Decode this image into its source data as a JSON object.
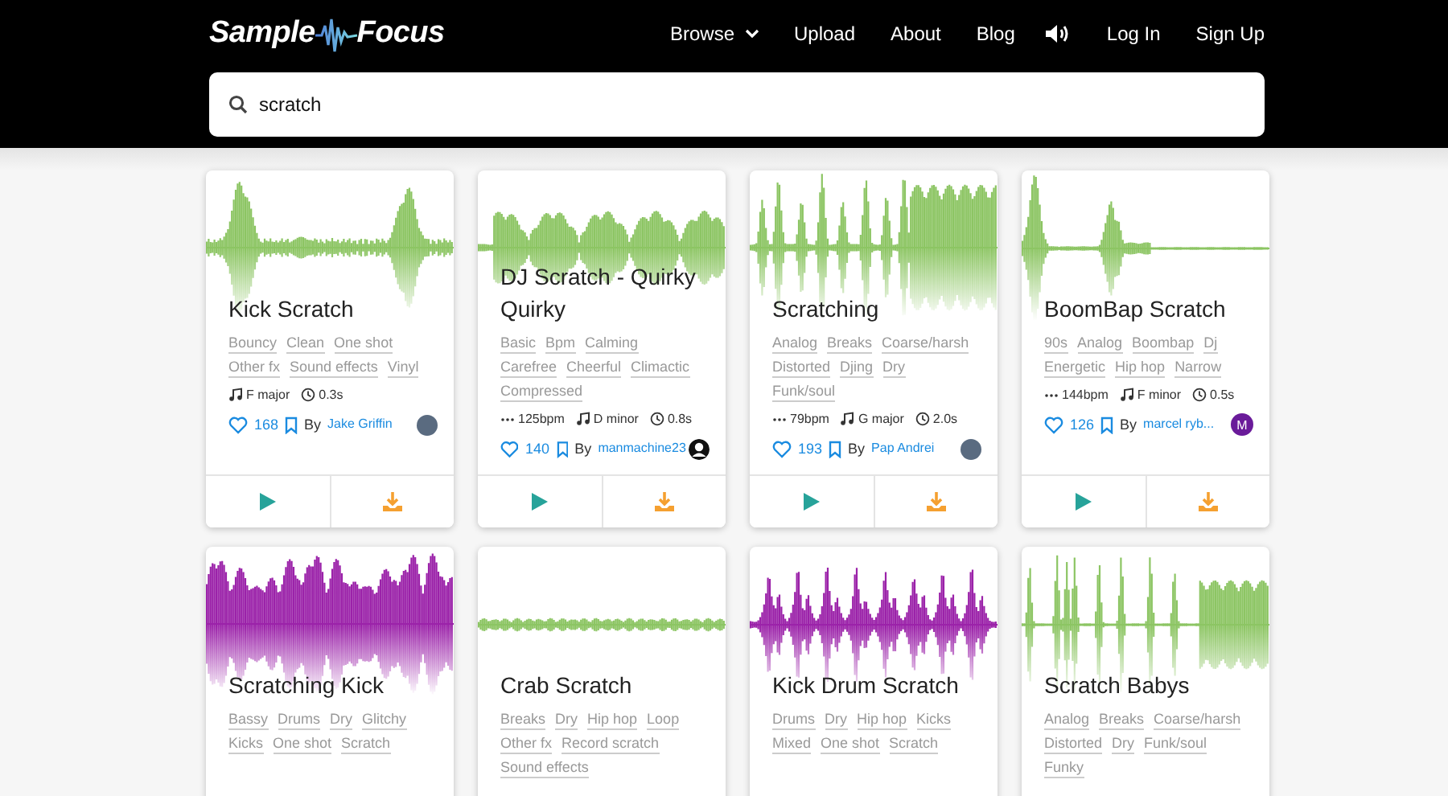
{
  "header": {
    "logo": {
      "left": "Sample",
      "right": "Focus"
    },
    "nav": [
      {
        "kind": "dropdown",
        "label": "Browse"
      },
      {
        "kind": "link",
        "label": "Upload"
      },
      {
        "kind": "link",
        "label": "About"
      },
      {
        "kind": "link",
        "label": "Blog"
      },
      {
        "kind": "sound"
      },
      {
        "kind": "link",
        "label": "Log In"
      },
      {
        "kind": "link",
        "label": "Sign Up"
      }
    ]
  },
  "search": {
    "value": "scratch"
  },
  "samples": [
    {
      "title": "Kick Scratch",
      "color": "#8cc563",
      "tags": [
        "Bouncy",
        "Clean",
        "One shot",
        "Other fx",
        "Sound effects",
        "Vinyl"
      ],
      "meta": [
        {
          "kind": "key",
          "text": "F major"
        },
        {
          "kind": "duration",
          "text": "0.3s"
        }
      ],
      "likes": "168",
      "by": "By",
      "author": "Jake Griffin",
      "avatar": {
        "kind": "photo"
      }
    },
    {
      "title": "DJ Scratch - Quirky Quirky",
      "color": "#8cc563",
      "tags": [
        "Basic",
        "Bpm",
        "Calming",
        "Carefree",
        "Cheerful",
        "Climactic",
        "Compressed"
      ],
      "meta": [
        {
          "kind": "bpm",
          "text": "125bpm"
        },
        {
          "kind": "key",
          "text": "D minor"
        },
        {
          "kind": "duration",
          "text": "0.8s"
        }
      ],
      "likes": "140",
      "by": "By",
      "author": "manmachine23",
      "avatar": {
        "kind": "silhouette"
      }
    },
    {
      "title": "Scratching",
      "color": "#8cc563",
      "tags": [
        "Analog",
        "Breaks",
        "Coarse/harsh",
        "Distorted",
        "Djing",
        "Dry",
        "Funk/soul"
      ],
      "meta": [
        {
          "kind": "bpm",
          "text": "79bpm"
        },
        {
          "kind": "key",
          "text": "G major"
        },
        {
          "kind": "duration",
          "text": "2.0s"
        }
      ],
      "likes": "193",
      "by": "By",
      "author": "Pap Andrei",
      "avatar": {
        "kind": "photo"
      }
    },
    {
      "title": "BoomBap Scratch",
      "color": "#8cc563",
      "tags": [
        "90s",
        "Analog",
        "Boombap",
        "Dj",
        "Energetic",
        "Hip hop",
        "Narrow"
      ],
      "meta": [
        {
          "kind": "bpm",
          "text": "144bpm"
        },
        {
          "kind": "key",
          "text": "F minor"
        },
        {
          "kind": "duration",
          "text": "0.5s"
        }
      ],
      "likes": "126",
      "by": "By",
      "author": "marcel ryb...",
      "avatar": {
        "kind": "letter",
        "text": "M"
      }
    },
    {
      "title": "Scratching Kick",
      "color": "#9b22a9",
      "tags": [
        "Bassy",
        "Drums",
        "Dry",
        "Glitchy",
        "Kicks",
        "One shot",
        "Scratch"
      ]
    },
    {
      "title": "Crab Scratch",
      "color": "#8cc563",
      "tags": [
        "Breaks",
        "Dry",
        "Hip hop",
        "Loop",
        "Other fx",
        "Record scratch",
        "Sound effects"
      ]
    },
    {
      "title": "Kick Drum Scratch",
      "color": "#9b22a9",
      "tags": [
        "Drums",
        "Dry",
        "Hip hop",
        "Kicks",
        "Mixed",
        "One shot",
        "Scratch"
      ]
    },
    {
      "title": "Scratch Babys",
      "color": "#8cc563",
      "tags": [
        "Analog",
        "Breaks",
        "Coarse/harsh",
        "Distorted",
        "Dry",
        "Funk/soul",
        "Funky"
      ]
    }
  ]
}
